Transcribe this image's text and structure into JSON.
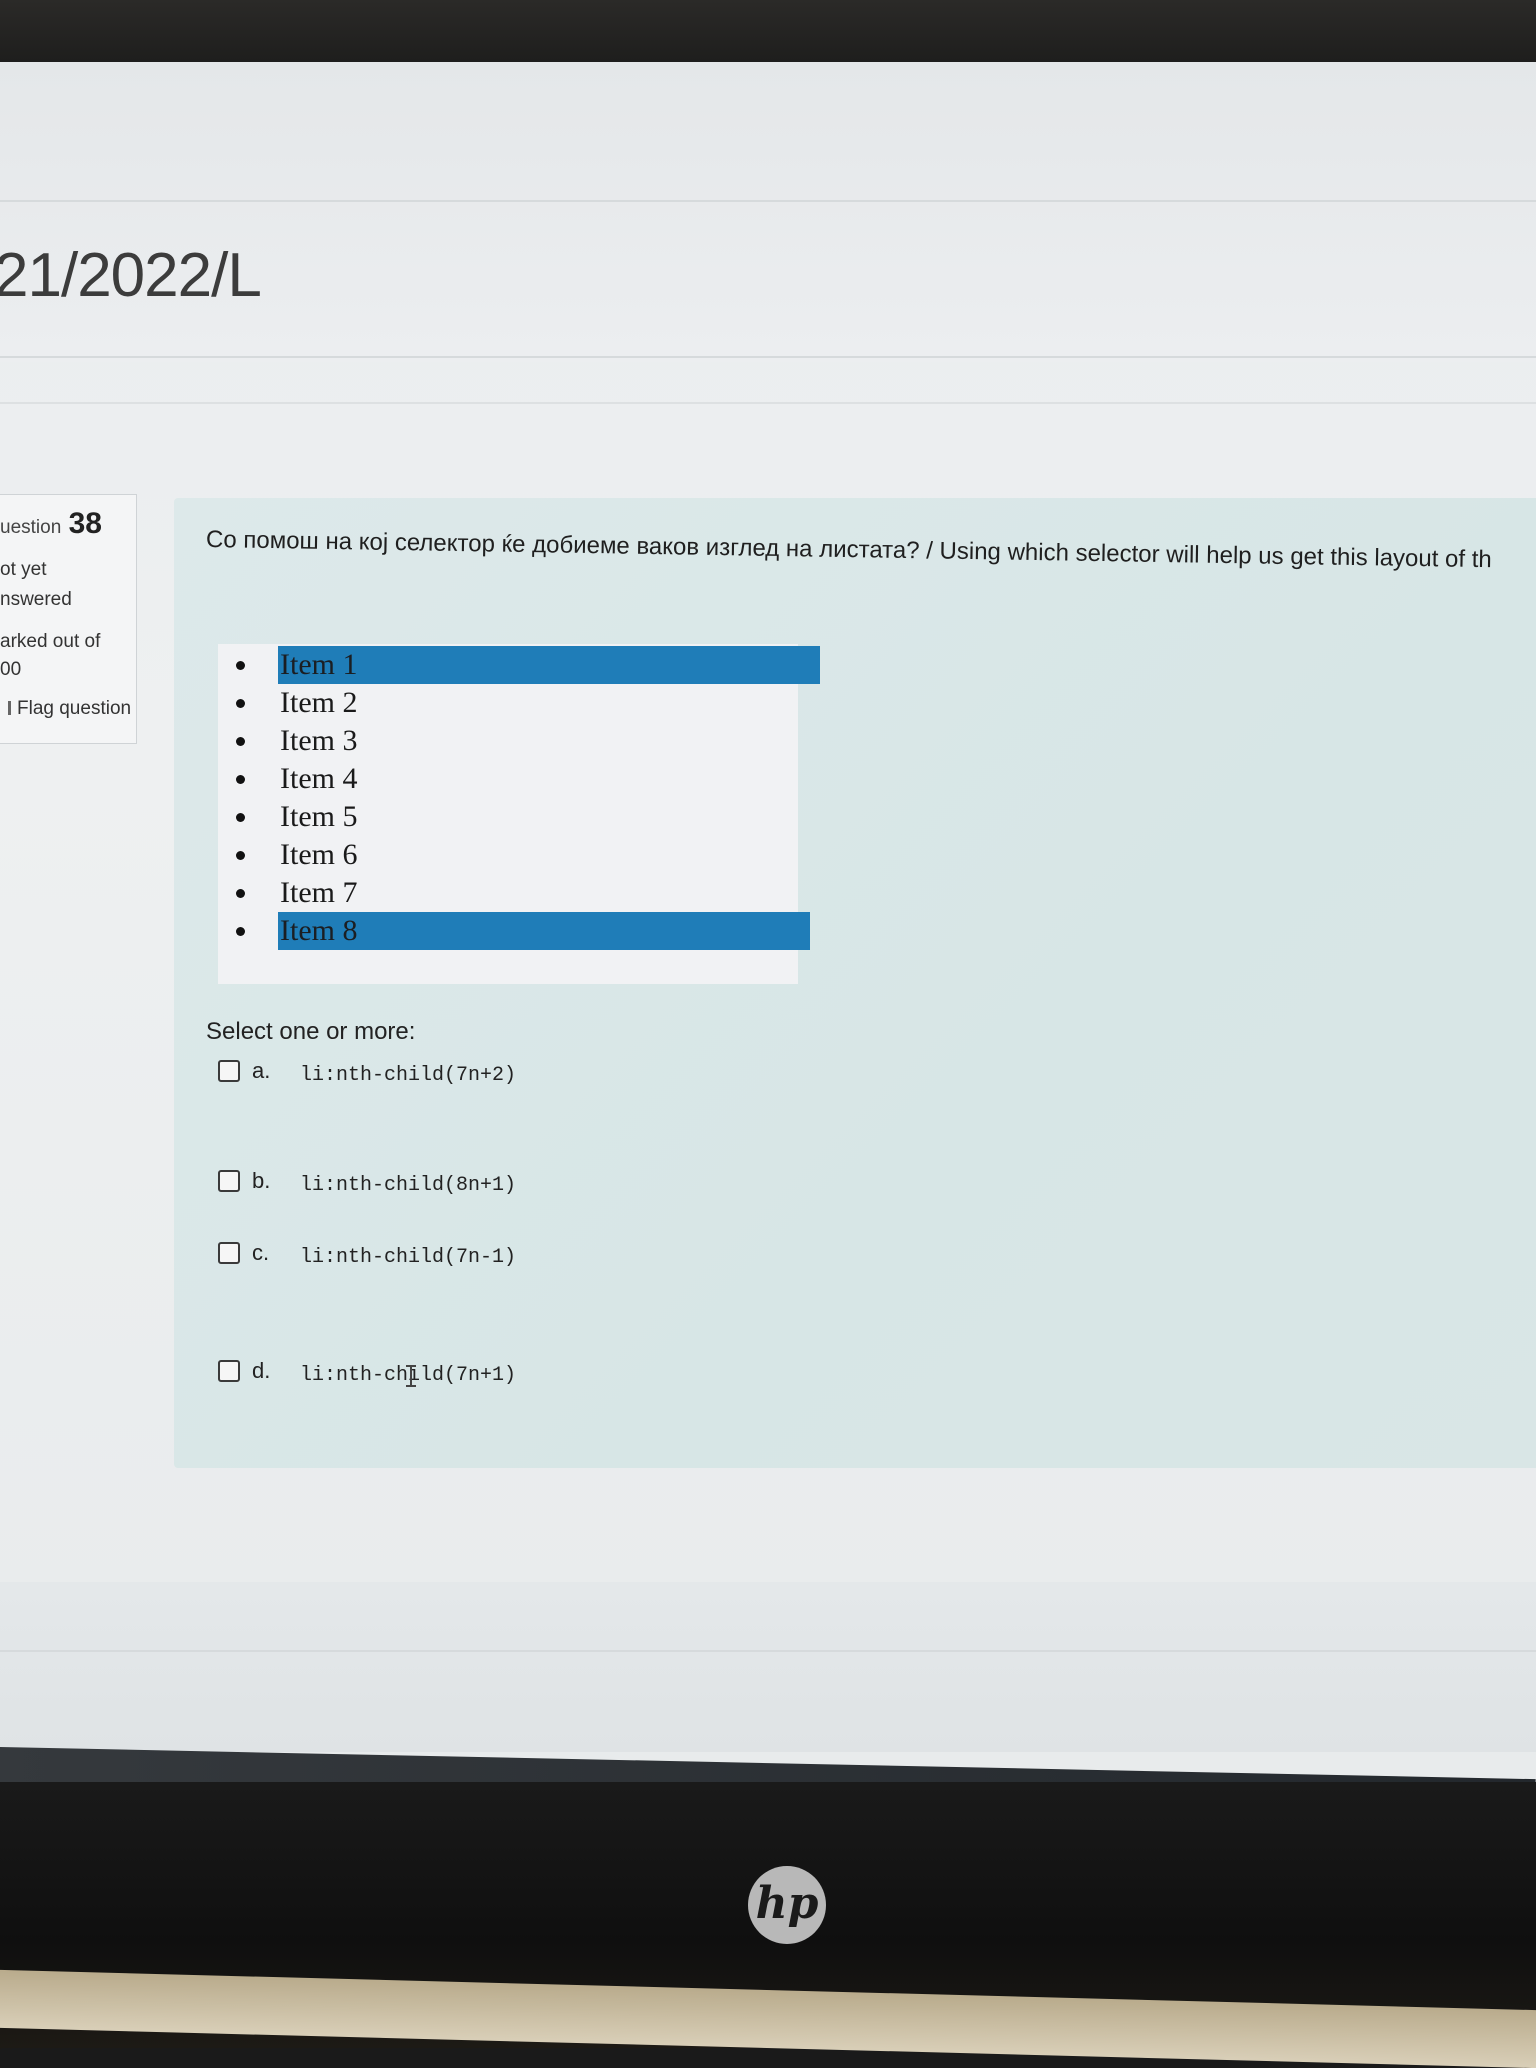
{
  "page": {
    "course_title": "21/2022/L"
  },
  "question_info": {
    "number_prefix": "uestion",
    "number": "38",
    "status_line1": "ot yet",
    "status_line2": "nswered",
    "marked_line1": "arked out of",
    "marked_line2": "00",
    "flag_label": "Flag question"
  },
  "question": {
    "text": "Со помош на кој селектор ќе добиеме ваков изглед на листата? / Using which selector will help us get this layout of th",
    "list_items": [
      {
        "label": "Item 1",
        "highlighted": true
      },
      {
        "label": "Item 2",
        "highlighted": false
      },
      {
        "label": "Item 3",
        "highlighted": false
      },
      {
        "label": "Item 4",
        "highlighted": false
      },
      {
        "label": "Item 5",
        "highlighted": false
      },
      {
        "label": "Item 6",
        "highlighted": false
      },
      {
        "label": "Item 7",
        "highlighted": false
      },
      {
        "label": "Item 8",
        "highlighted": true
      }
    ],
    "highlight_color": "#1f7db8",
    "prompt": "Select one or more:",
    "options": [
      {
        "letter": "a.",
        "code": "li:nth-child(7n+2)",
        "checked": false
      },
      {
        "letter": "b.",
        "code": "li:nth-child(8n+1)",
        "checked": false
      },
      {
        "letter": "c.",
        "code": "li:nth-child(7n-1)",
        "checked": false
      },
      {
        "letter": "d.",
        "code": "li:nth-child(7n+1)",
        "checked": false
      }
    ]
  },
  "device": {
    "logo_text": "hp"
  }
}
